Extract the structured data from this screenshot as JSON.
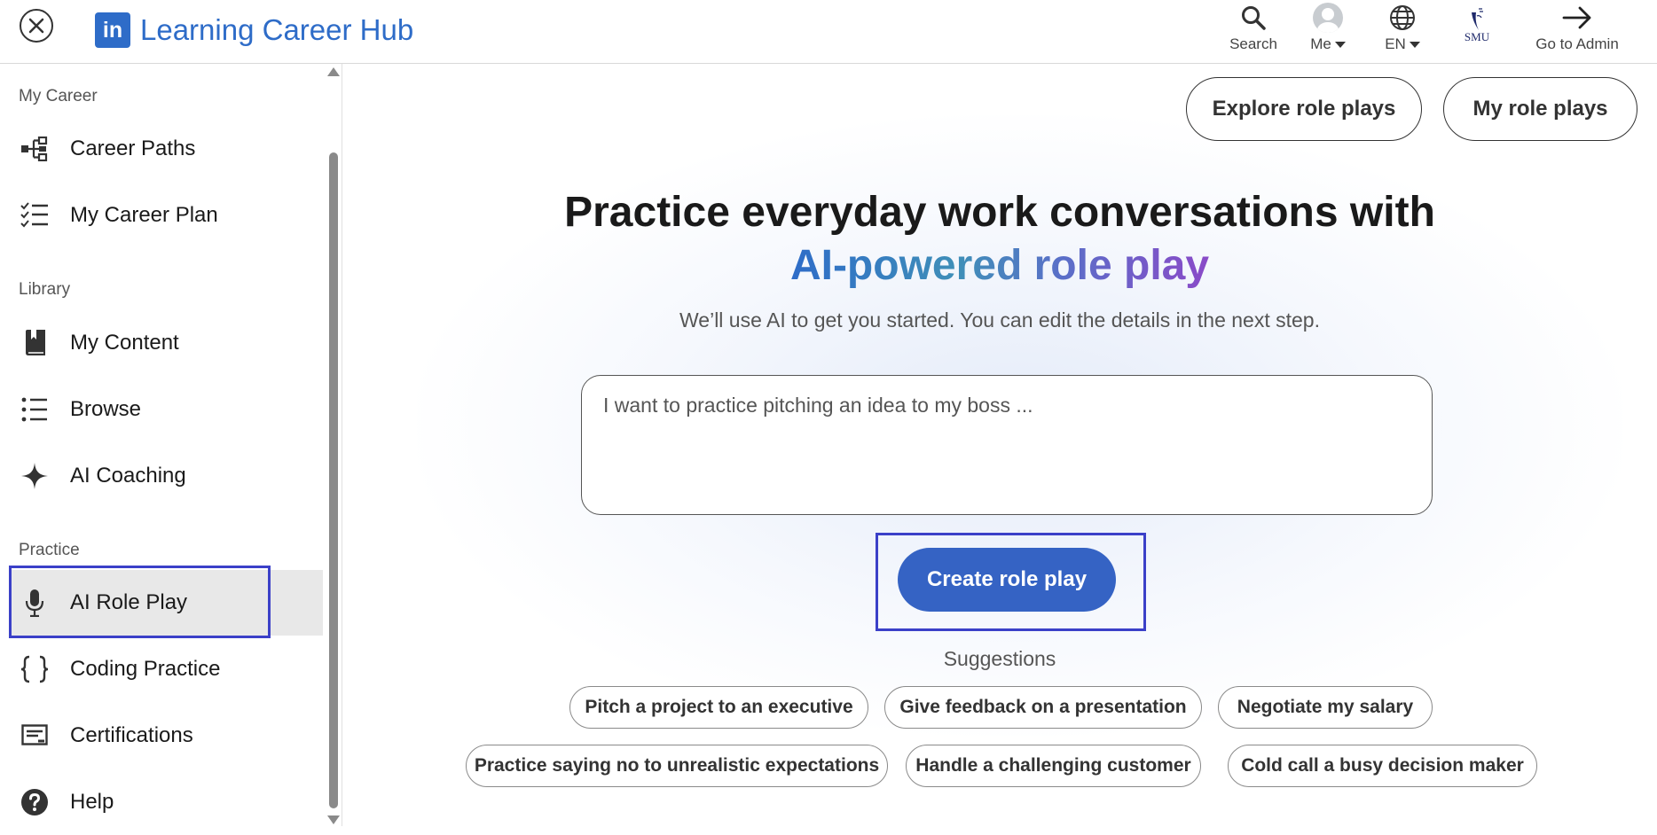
{
  "header": {
    "app_title": "Learning Career Hub",
    "logo_text": "in",
    "nav": {
      "search": "Search",
      "me": "Me",
      "language": "EN",
      "org": "SMU",
      "admin": "Go to Admin"
    }
  },
  "sidebar": {
    "sections": {
      "career": "My Career",
      "library": "Library",
      "practice": "Practice"
    },
    "items": [
      {
        "label": "Career Paths",
        "icon": "career-paths-icon"
      },
      {
        "label": "My Career Plan",
        "icon": "checklist-icon"
      },
      {
        "label": "My Content",
        "icon": "book-icon"
      },
      {
        "label": "Browse",
        "icon": "list-icon"
      },
      {
        "label": "AI Coaching",
        "icon": "sparkle-icon"
      },
      {
        "label": "AI Role Play",
        "icon": "microphone-icon",
        "active": true
      },
      {
        "label": "Coding Practice",
        "icon": "braces-icon"
      },
      {
        "label": "Certifications",
        "icon": "certificate-icon"
      },
      {
        "label": "Help",
        "icon": "help-icon"
      }
    ]
  },
  "main": {
    "explore_button": "Explore role plays",
    "my_role_plays_button": "My role plays",
    "hero_line1": "Practice everyday work conversations with",
    "hero_line2": "AI-powered role play",
    "subtext": "We’ll use AI to get you started. You can edit the details in the next step.",
    "prompt_placeholder": "I want to practice pitching an idea to my boss ...",
    "create_button": "Create role play",
    "suggestions_title": "Suggestions",
    "suggestions": [
      "Pitch a project to an executive",
      "Give feedback on a presentation",
      "Negotiate my salary",
      "Practice saying no to unrealistic expectations",
      "Handle a challenging customer",
      "Cold call a busy decision maker"
    ]
  },
  "colors": {
    "brand_blue": "#2e6cc8",
    "primary_button": "#3563c4",
    "highlight_outline": "#3b40c8",
    "active_bg": "#e8e8e8"
  }
}
